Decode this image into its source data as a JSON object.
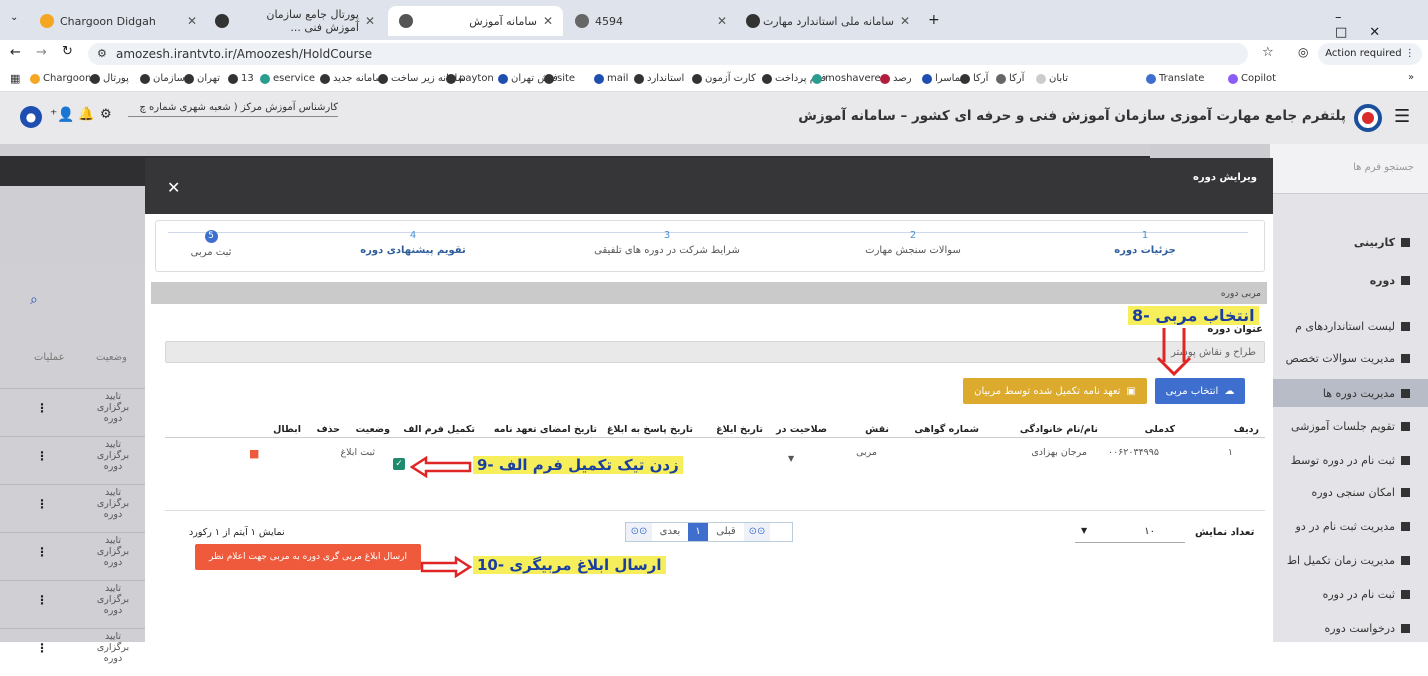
{
  "browser": {
    "tabs": [
      {
        "title": "Chargoon Didgah"
      },
      {
        "title": "پورتال جامع سازمان آموزش فنی ..."
      },
      {
        "title": "سامانه آموزش"
      },
      {
        "title": "4594"
      },
      {
        "title": "سامانه ملی استاندارد مهارت"
      }
    ],
    "url": "amozesh.irantvto.ir/Amoozesh/HoldCourse",
    "action_required": "Action required",
    "bookmarks": [
      "Chargoon",
      "پورتال",
      "سازمان",
      "تهران",
      "13",
      "eservice",
      "سامانه جدید",
      "سامانه زیر ساخت",
      "payton",
      "فیش تهران",
      "site",
      "mail",
      "استاندارد",
      "کارت آزمون",
      "فرم پرداخت",
      "moshavere",
      "رصد",
      "مهماسرا",
      "آرکا",
      "آرکا",
      "تابان",
      "Translate",
      "Copilot"
    ],
    "more_label": "»"
  },
  "app": {
    "title": "پلتفرم جامع مهارت آموزی سازمان آموزش فنی و حرفه ای کشور – سامانه آموزش",
    "user_role": "کارشناس آموزش مرکز ( شعبه شهری شماره چ",
    "search_forms_placeholder": "جستجو فرم ها"
  },
  "sidebar": {
    "sections": [
      "کاربینی",
      "دوره"
    ],
    "items": [
      "لیست استانداردهای م",
      "مدیریت سوالات تخصص",
      "مدیریت دوره ها",
      "تقویم جلسات آموزشی",
      "ثبت نام در دوره توسط",
      "امکان سنجی دوره",
      "مدیریت ثبت نام در دو",
      "مدیریت زمان تکمیل اط",
      "ثبت نام در دوره",
      "درخواست دوره"
    ]
  },
  "background_table": {
    "col_status": "وضعیت",
    "col_ops": "عملیات",
    "rows": [
      "تایید برگزاری دوره",
      "تایید برگزاری دوره",
      "تایید برگزاری دوره",
      "تایید برگزاری دوره",
      "تایید برگزاری دوره",
      "تایید برگزاری دوره"
    ]
  },
  "modal": {
    "title": "ویرایش دوره",
    "close_label": "✕",
    "steps": [
      {
        "num": "1",
        "label": "جزئیات دوره"
      },
      {
        "num": "2",
        "label": "سوالات سنجش مهارت"
      },
      {
        "num": "3",
        "label": "شرایط شرکت در دوره های تلفیقی"
      },
      {
        "num": "4",
        "label": "تقویم پیشنهادی دوره"
      },
      {
        "num": "5",
        "label": "ثبت مربی"
      }
    ],
    "section_title": "مربی دوره",
    "field_label": "عنوان دوره",
    "field_value": "طراح و نقاش پوستر",
    "select_trainer_btn": "انتخاب مربی",
    "commit_btn": "تعهد نامه تکمیل شده توسط مربیان",
    "table": {
      "headers": [
        "ردیف",
        "کدملی",
        "نام/نام خانوادگی",
        "شماره گواهی",
        "نقش",
        "صلاحیت در",
        "تاریخ ابلاغ",
        "تاریخ پاسخ به ابلاغ",
        "تاریخ امضای تعهد نامه",
        "تکمیل فرم الف",
        "وضعیت",
        "حذف",
        "ابطال"
      ],
      "rows": [
        {
          "row": "۱",
          "national_id": "۰۰۶۲۰۳۴۹۹۵",
          "name": "مرجان بهزادی",
          "cert": "",
          "role": "مربی",
          "status": "ثبت ابلاغ"
        }
      ]
    },
    "page_size_label": "تعداد نمایش",
    "page_size": "۱۰",
    "prev": "قبلی",
    "next": "بعدی",
    "current_page": "۱",
    "record_info": "نمایش ۱ آیتم از ۱ رکورد",
    "send_btn": "ارسال ابلاغ مربی گری دوره به مربی جهت اعلام نظر"
  },
  "annotations": {
    "a8": "8- انتخاب مربی",
    "a9": "9- زدن تیک تکمیل فرم الف",
    "a10": "10- ارسال ابلاغ مربیگری"
  },
  "colors": {
    "blue_btn": "#3f6fce",
    "yellow_btn": "#dcaa2c",
    "red_btn": "#ee5a3b",
    "annotation_bg": "#f6ef5b",
    "annotation_text": "#1b3fa0",
    "arrow": "#e02525"
  }
}
